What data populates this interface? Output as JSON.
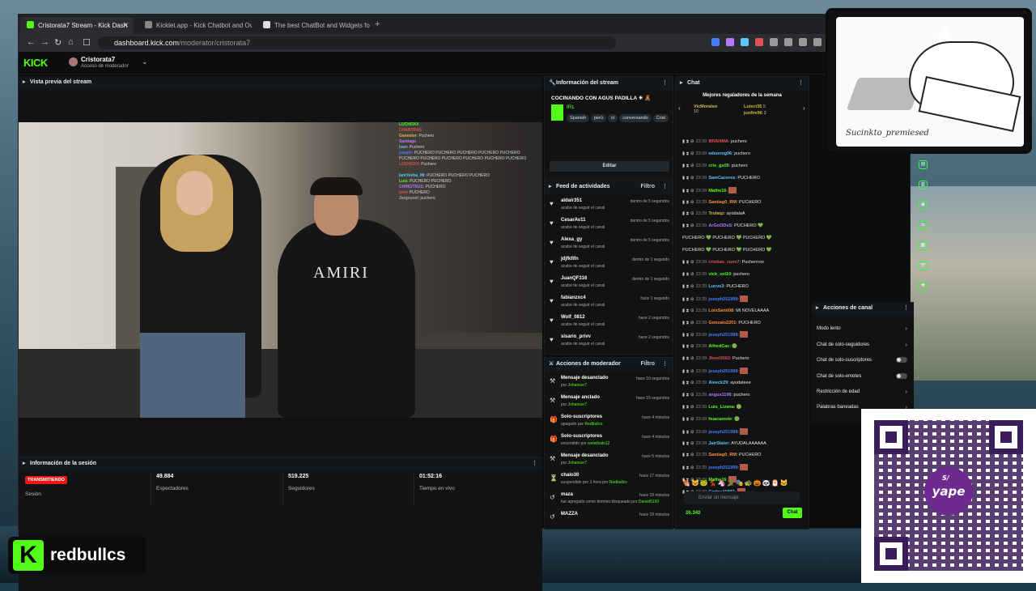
{
  "browser": {
    "tabs": [
      {
        "label": "Cristorata7 Stream - Kick Dash",
        "active": true,
        "icon_color": "#53fc18"
      },
      {
        "label": "Kicklet.app - Kick Chatbot and Overl",
        "active": false,
        "icon_color": "#888888"
      },
      {
        "label": "The best ChatBot and Widgets for Kic",
        "active": false,
        "icon_color": "#dddddd"
      }
    ],
    "url_host": "dashboard.kick.com",
    "url_path": "/moderator/cristorata7"
  },
  "header": {
    "logo": "KICK",
    "channel_name": "Cristorata7",
    "channel_role": "Acceso de moderador"
  },
  "preview": {
    "title": "Vista previa del stream",
    "overlay_lines": [
      {
        "user": "LUCHOXX",
        "text": ""
      },
      {
        "user": "CHANTRAS",
        "text": ""
      },
      {
        "user": "Ganester",
        "text": "Puchero"
      },
      {
        "user": "Santiago",
        "text": ""
      },
      {
        "user": "Ivan",
        "text": "Puchero"
      },
      {
        "user": "joseph",
        "text": "PUCHERO PUCHERO PUCHERO PUCHERO PUCHERO"
      },
      {
        "user": "",
        "text": "PUCHERO PUCHERO PUCHERO PUCHERO PUCHERO PUCHERO"
      },
      {
        "user": "LUCHOXX",
        "text": "Puchero"
      },
      {
        "user": "",
        "text": ""
      },
      {
        "user": "IamYeeha_MI",
        "text": "PUCHERO PUCHERO PUCHERO"
      },
      {
        "user": "Luis",
        "text": "PUCHERO PUCHERO"
      },
      {
        "user": "CHINGTRUS",
        "text": "PUCHERO"
      },
      {
        "user": "ivan",
        "text": "PUCHERO"
      },
      {
        "user": "Jorgeyoel",
        "text": "puchero"
      }
    ],
    "shirt_text": "AMIRI"
  },
  "session": {
    "title": "Información de la sesión",
    "status": "TRANSMITIENDO",
    "status_label": "Sesión",
    "stats": [
      {
        "value": "49.884",
        "label": "Espectadores"
      },
      {
        "value": "519.225",
        "label": "Seguidores"
      },
      {
        "value": "01:52:16",
        "label": "Tiempo en vivo"
      }
    ]
  },
  "stream_info": {
    "title": "Información del stream",
    "stream_title": "COCINANDO CON AGUS PADILLA ☀ 🧸",
    "category": "IRL",
    "tags": [
      "Spanish",
      "perú",
      "ct",
      "conversando",
      "Crist"
    ],
    "edit_label": "Editar"
  },
  "activity": {
    "title": "Feed de actividades",
    "filter": "Filtro",
    "items": [
      {
        "name": "aldair351",
        "desc": "acaba de seguir el canal",
        "time": "dentro de 5 segundos"
      },
      {
        "name": "CesarAv11",
        "desc": "acaba de seguir el canal",
        "time": "dentro de 5 segundos"
      },
      {
        "name": "Alexa_gy",
        "desc": "acaba de seguir el canal",
        "time": "dentro de 5 segundos"
      },
      {
        "name": "jdjfkfifn",
        "desc": "acaba de seguir el canal",
        "time": "dentro de 1 segundo"
      },
      {
        "name": "JuanQF316",
        "desc": "acaba de seguir el canal",
        "time": "dentro de 1 segundo"
      },
      {
        "name": "fabianzxc4",
        "desc": "acaba de seguir el canal",
        "time": "hace 1 segundo"
      },
      {
        "name": "Wolf_0812",
        "desc": "acaba de seguir el canal",
        "time": "hace 2 segundos"
      },
      {
        "name": "sisario_privv",
        "desc": "acaba de seguir el canal",
        "time": "hace 2 segundos"
      }
    ]
  },
  "mod_actions": {
    "title": "Acciones de moderador",
    "filter": "Filtro",
    "items": [
      {
        "icon": "⚒",
        "name": "Mensaje desanclado",
        "desc": "por ",
        "user": "Johanser7",
        "time": "hace 10 segundos"
      },
      {
        "icon": "⚒",
        "name": "Mensaje anclado",
        "desc": "por ",
        "user": "Johanser7",
        "time": "hace 15 segundos"
      },
      {
        "icon": "🎁",
        "name": "Solo-suscriptores",
        "desc": "apagado por ",
        "user": "Redbullcs",
        "time": "hace 4 minutos"
      },
      {
        "icon": "🎁",
        "name": "Solo-suscriptores",
        "desc": "encendido por ",
        "user": "welwlbalo12",
        "time": "hace 4 minutos"
      },
      {
        "icon": "⚒",
        "name": "Mensaje desanclado",
        "desc": "por ",
        "user": "Johanser7",
        "time": "hace 5 minutos"
      },
      {
        "icon": "⏳",
        "name": "chalo30",
        "desc": "suspendido por 1 hora por ",
        "user": "Redbullcs",
        "time": "hace 17 minutos"
      },
      {
        "icon": "↺",
        "name": "maza",
        "desc": "fue agregado como término bloqueado por ",
        "user": "Daniel5193",
        "time": "hace 19 minutos"
      },
      {
        "icon": "↺",
        "name": "MAZZA",
        "desc": "",
        "user": "",
        "time": "hace 19 minutos"
      }
    ]
  },
  "chat": {
    "title": "Chat",
    "gifters_title": "Mejores regaladores de la semana",
    "gifters": [
      {
        "name": "VicMoraleo",
        "value": "10"
      },
      {
        "name": "Luisct35",
        "value": "5"
      },
      {
        "name": "junfire96",
        "value": "3"
      }
    ],
    "messages": [
      {
        "time": "23:39",
        "user": "BRAHMA",
        "color": "#e05050",
        "text": "puchero",
        "emote": false
      },
      {
        "time": "23:39",
        "user": "edsonvg06",
        "color": "#5ac8fa",
        "text": "puchero",
        "emote": false
      },
      {
        "time": "23:39",
        "user": "cris_gs05",
        "color": "#53fc18",
        "text": "puchero",
        "emote": false
      },
      {
        "time": "23:39",
        "user": "SamCaceres",
        "color": "#5ac8fa",
        "text": "PUCHERO",
        "emote": false
      },
      {
        "time": "23:39",
        "user": "Mathe16",
        "color": "#53fc18",
        "text": "",
        "emote": true
      },
      {
        "time": "23:39",
        "user": "Santiag0_RM",
        "color": "#ff8c3a",
        "text": "PUCHERO",
        "emote": false
      },
      {
        "time": "23:39",
        "user": "Trulaqz",
        "color": "#e0b83a",
        "text": "ayúdalaA",
        "emote": false
      },
      {
        "time": "23:39",
        "user": "ArGoODsS",
        "color": "#b678ff",
        "text": "PUCHERO 💚",
        "emote": false
      },
      {
        "time": "",
        "user": "",
        "color": "#e5e5e5",
        "text": "PUCHERO 💚 PUCHERO 💚 PUCHERO 💚",
        "emote": false
      },
      {
        "time": "",
        "user": "",
        "color": "#e5e5e5",
        "text": "PUCHERO 💚 PUCHERO 💚 PUCHERO 💚",
        "emote": false
      },
      {
        "time": "23:39",
        "user": "cristian_cuev7",
        "color": "#e05050",
        "text": "Pucherrroo",
        "emote": false
      },
      {
        "time": "23:39",
        "user": "vick_xet10",
        "color": "#53fc18",
        "text": "puchero",
        "emote": false
      },
      {
        "time": "23:39",
        "user": "Lucvs3",
        "color": "#5ac8fa",
        "text": "PUCHERO",
        "emote": false
      },
      {
        "time": "23:39",
        "user": "joseph251999",
        "color": "#4a7cff",
        "text": "",
        "emote": true
      },
      {
        "time": "23:39",
        "user": "LoisSanti08",
        "color": "#ff8c3a",
        "text": "MI NOVELAAAA",
        "emote": false
      },
      {
        "time": "23:39",
        "user": "Gonzalo2201",
        "color": "#ff8c3a",
        "text": "PUCHERO",
        "emote": false
      },
      {
        "time": "23:39",
        "user": "joseph251999",
        "color": "#4a7cff",
        "text": "",
        "emote": true
      },
      {
        "time": "23:39",
        "user": "AlfredCac",
        "color": "#53fc18",
        "text": "🟢",
        "emote": false
      },
      {
        "time": "23:39",
        "user": "Jhoel2002",
        "color": "#e05050",
        "text": "Puchero",
        "emote": false
      },
      {
        "time": "23:39",
        "user": "joseph251999",
        "color": "#4a7cff",
        "text": "",
        "emote": true
      },
      {
        "time": "23:39",
        "user": "Aleeck29",
        "color": "#5ac8fa",
        "text": "ayudaleee",
        "emote": false
      },
      {
        "time": "23:39",
        "user": "angus1108",
        "color": "#b678ff",
        "text": "puchero",
        "emote": false
      },
      {
        "time": "23:39",
        "user": "Luis_Lizana",
        "color": "#53fc18",
        "text": "🟢",
        "emote": false
      },
      {
        "time": "23:39",
        "user": "huacamole",
        "color": "#53fc18",
        "text": "🟢",
        "emote": false
      },
      {
        "time": "23:39",
        "user": "joseph251999",
        "color": "#4a7cff",
        "text": "",
        "emote": true
      },
      {
        "time": "23:39",
        "user": "JairSlater",
        "color": "#5ac8fa",
        "text": "AYUDALAAAAAA",
        "emote": false
      },
      {
        "time": "23:39",
        "user": "Santiag0_RM",
        "color": "#ff8c3a",
        "text": "PUCHERO",
        "emote": false
      },
      {
        "time": "23:39",
        "user": "joseph251999",
        "color": "#4a7cff",
        "text": "",
        "emote": true
      },
      {
        "time": "23:39",
        "user": "Mathe16",
        "color": "#53fc18",
        "text": "",
        "emote": true
      },
      {
        "time": "23:39",
        "user": "Carlos11992",
        "color": "#5ac8fa",
        "text": "",
        "emote": true
      }
    ],
    "emote_bar": "🍖😺🐸💃🦄🐊🎭🐢🎃🐼🎅🐱",
    "input_placeholder": "Enviar un mensaje",
    "points": "26.340",
    "send_label": "Chat"
  },
  "channel_actions": {
    "title": "Acciones de canal",
    "items": [
      {
        "label": "Modo lento",
        "type": "arrow"
      },
      {
        "label": "Chat de solo-seguidores",
        "type": "arrow"
      },
      {
        "label": "Chat de solo-suscriptores",
        "type": "toggle"
      },
      {
        "label": "Chat de solo-emotes",
        "type": "toggle"
      },
      {
        "label": "Restricción de edad",
        "type": "arrow"
      },
      {
        "label": "Palabras baneadas",
        "type": "arrow"
      }
    ]
  },
  "webcam": {
    "signature": "Sucinkto_premiesed"
  },
  "qr": {
    "brand": "yape",
    "brand_mark": "S/"
  },
  "branding": {
    "badge": "K",
    "name": "redbullcs"
  }
}
